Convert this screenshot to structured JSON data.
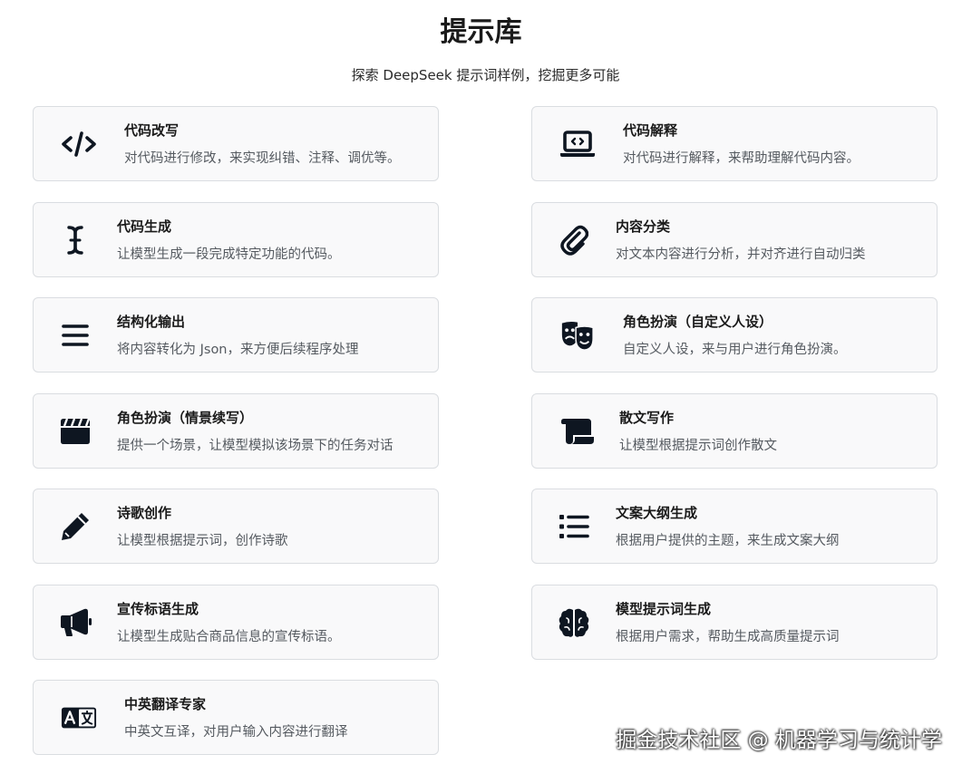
{
  "header": {
    "title": "提示库",
    "subtitle": "探索 DeepSeek 提示词样例，挖掘更多可能"
  },
  "cards": [
    {
      "title": "代码改写",
      "desc": "对代码进行修改，来实现纠错、注释、调优等。",
      "icon": "code-icon"
    },
    {
      "title": "代码解释",
      "desc": "对代码进行解释，来帮助理解代码内容。",
      "icon": "laptop-code-icon"
    },
    {
      "title": "代码生成",
      "desc": "让模型生成一段完成特定功能的代码。",
      "icon": "text-cursor-icon"
    },
    {
      "title": "内容分类",
      "desc": "对文本内容进行分析，并对齐进行自动归类",
      "icon": "paperclip-icon"
    },
    {
      "title": "结构化输出",
      "desc": "将内容转化为 Json，来方便后续程序处理",
      "icon": "bars-icon"
    },
    {
      "title": "角色扮演（自定义人设）",
      "desc": "自定义人设，来与用户进行角色扮演。",
      "icon": "theater-masks-icon"
    },
    {
      "title": "角色扮演（情景续写）",
      "desc": "提供一个场景，让模型模拟该场景下的任务对话",
      "icon": "clapperboard-icon"
    },
    {
      "title": "散文写作",
      "desc": "让模型根据提示词创作散文",
      "icon": "scroll-icon"
    },
    {
      "title": "诗歌创作",
      "desc": "让模型根据提示词，创作诗歌",
      "icon": "pencil-icon"
    },
    {
      "title": "文案大纲生成",
      "desc": "根据用户提供的主题，来生成文案大纲",
      "icon": "list-icon"
    },
    {
      "title": "宣传标语生成",
      "desc": "让模型生成贴合商品信息的宣传标语。",
      "icon": "megaphone-icon"
    },
    {
      "title": "模型提示词生成",
      "desc": "根据用户需求，帮助生成高质量提示词",
      "icon": "brain-icon"
    },
    {
      "title": "中英翻译专家",
      "desc": "中英文互译，对用户输入内容进行翻译",
      "icon": "language-icon"
    }
  ],
  "watermark": "掘金技术社区 @ 机器学习与统计学",
  "colors": {
    "card_background": "#f9f9fa",
    "card_border": "#dadde1",
    "icon": "#0e1621",
    "description_text": "#555a60"
  }
}
